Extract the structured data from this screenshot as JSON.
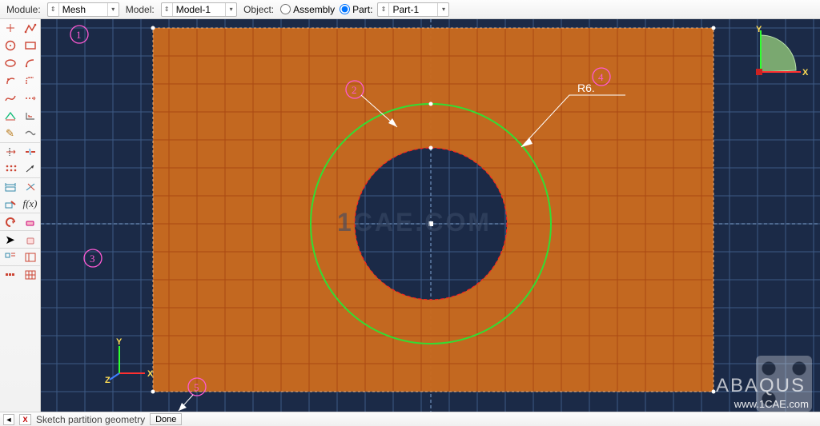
{
  "toolbar": {
    "module_label": "Module:",
    "module_value": "Mesh",
    "model_label": "Model:",
    "model_value": "Model-1",
    "object_label": "Object:",
    "assembly_label": "Assembly",
    "part_label": "Part:",
    "part_value": "Part-1",
    "object_mode": "Part"
  },
  "annotations": {
    "a1": "1",
    "a2": "2",
    "a3": "3",
    "a4": "4",
    "a5": "5",
    "dim_r": "R6."
  },
  "triad": {
    "x": "X",
    "y": "Y",
    "z": "Z"
  },
  "status": {
    "prompt": "Sketch partition geometry",
    "done": "Done"
  },
  "watermarks": {
    "center": "1CAE.COM",
    "brand": "ABAQUS",
    "site": "www.1CAE.com"
  },
  "colors": {
    "background": "#1b2a47",
    "part": "#c96a1f",
    "circle_marker": "#33dd33",
    "annotation": "#ff5ad4"
  },
  "chart_data": {
    "type": "diagram",
    "note": "2D sketch view of rectangular plate with centered circular hole and concentric partition circle",
    "plate": {
      "width_units": 20,
      "height_units": 14
    },
    "hole": {
      "shape": "circle",
      "radius_units": 4,
      "centered": true
    },
    "partition_circle": {
      "radius_value": 6,
      "label": "R6."
    }
  }
}
